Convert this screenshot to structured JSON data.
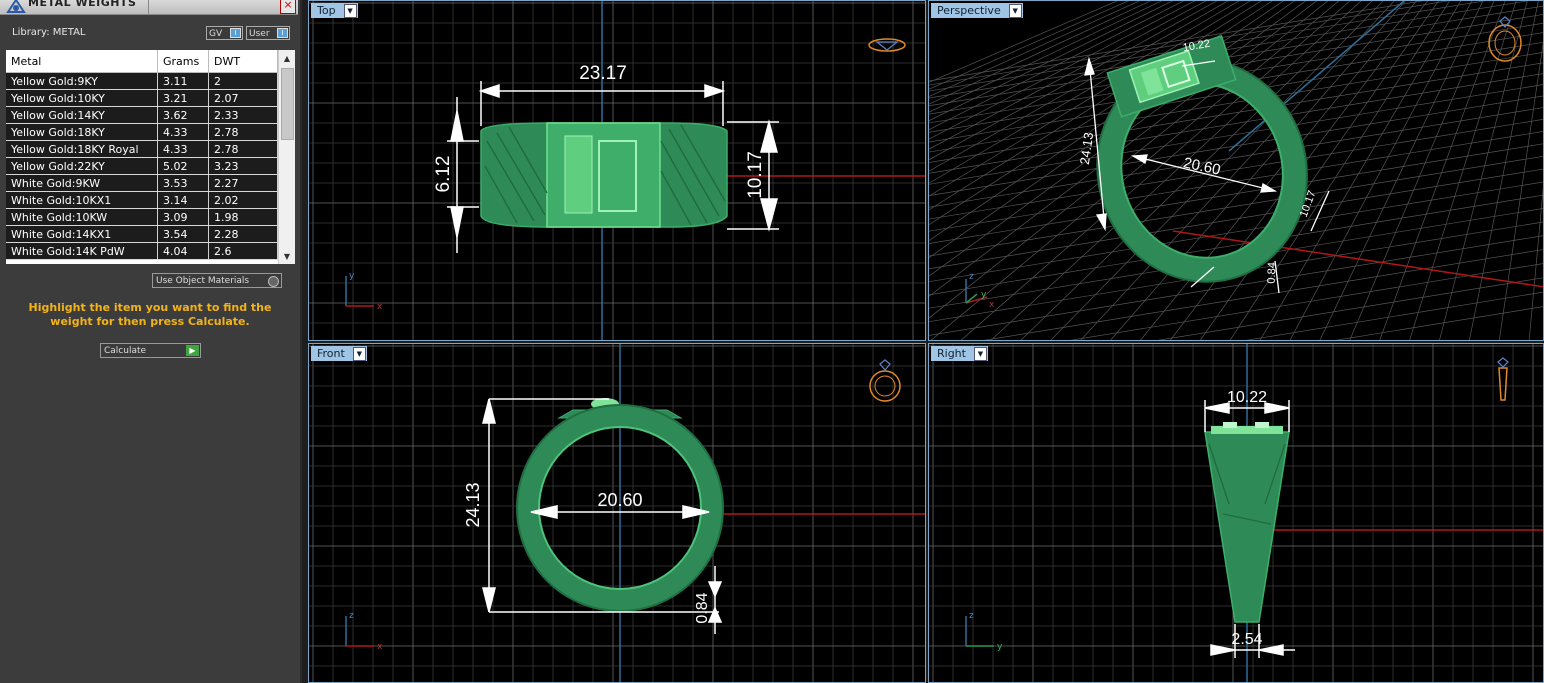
{
  "panel": {
    "title": "METAL WEIGHTS",
    "close_label": "×",
    "library_label": "Library: METAL",
    "toggle_gv": "GV",
    "toggle_user": "User",
    "columns": [
      "Metal",
      "Grams",
      "DWT"
    ],
    "rows": [
      [
        "Yellow Gold:9KY",
        "3.11",
        "2"
      ],
      [
        "Yellow Gold:10KY",
        "3.21",
        "2.07"
      ],
      [
        "Yellow Gold:14KY",
        "3.62",
        "2.33"
      ],
      [
        "Yellow Gold:18KY",
        "4.33",
        "2.78"
      ],
      [
        "Yellow Gold:18KY Royal",
        "4.33",
        "2.78"
      ],
      [
        "Yellow Gold:22KY",
        "5.02",
        "3.23"
      ],
      [
        "White Gold:9KW",
        "3.53",
        "2.27"
      ],
      [
        "White Gold:10KX1",
        "3.14",
        "2.02"
      ],
      [
        "White Gold:10KW",
        "3.09",
        "1.98"
      ],
      [
        "White Gold:14KX1",
        "3.54",
        "2.28"
      ],
      [
        "White Gold:14K PdW",
        "4.04",
        "2.6"
      ]
    ],
    "use_object_materials": "Use Object Materials",
    "hint": "Highlight the item you want to find the weight for then press Calculate.",
    "calculate_label": "Calculate"
  },
  "viewports": {
    "top": {
      "label": "Top",
      "dims": {
        "width": "23.17",
        "left_height": "6.12",
        "right_height": "10.17"
      }
    },
    "perspective": {
      "label": "Perspective",
      "dims": {
        "top_width": "10.22",
        "height": "24.13",
        "inner": "20.60",
        "side": "10.17",
        "bottom": "0.84"
      }
    },
    "front": {
      "label": "Front",
      "dims": {
        "height": "24.13",
        "inner": "20.60",
        "bottom": "0.84"
      }
    },
    "right": {
      "label": "Right",
      "dims": {
        "top_width": "10.22",
        "bottom_width": "2.54"
      }
    }
  },
  "colors": {
    "ring_green": "#2e8b57",
    "ring_light": "#5fcf7f",
    "grid": "#3a3a3a",
    "axis_red": "#b01818",
    "axis_blue": "#2f6f9a",
    "label_bg": "#9fc4e4",
    "hint": "#f3b31a",
    "icon_orange": "#e08a2c"
  }
}
